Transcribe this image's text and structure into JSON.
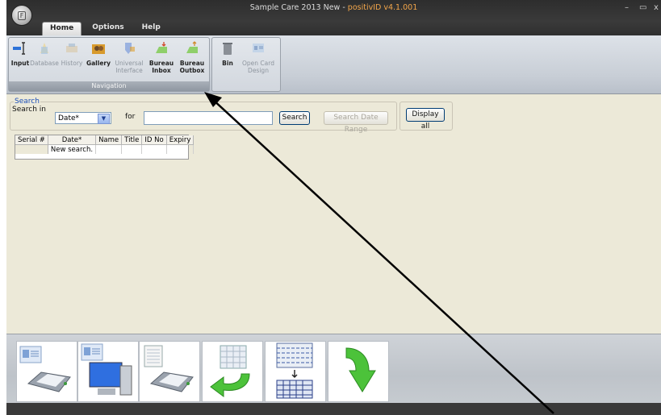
{
  "window": {
    "title_prefix": "Sample Care 2013 New - ",
    "title_brand": "positivID v4.1.001",
    "app_button_glyph": "F",
    "controls": {
      "minimize": "–",
      "maximize": "▭",
      "close": "x"
    }
  },
  "tabs": [
    {
      "label": "Home"
    },
    {
      "label": "Options"
    },
    {
      "label": "Help"
    }
  ],
  "ribbon": {
    "navigation": {
      "label": "Navigation",
      "buttons": [
        {
          "l1": "Input",
          "l2": "",
          "icon": "input-icon"
        },
        {
          "l1": "Database",
          "l2": "",
          "icon": "database-icon"
        },
        {
          "l1": "History",
          "l2": "",
          "icon": "history-icon"
        },
        {
          "l1": "Gallery",
          "l2": "",
          "icon": "gallery-icon"
        },
        {
          "l1": "Universal",
          "l2": "Interface",
          "icon": "universal-interface-icon"
        },
        {
          "l1": "Bureau",
          "l2": "Inbox",
          "icon": "bureau-inbox-icon"
        },
        {
          "l1": "Bureau",
          "l2": "Outbox",
          "icon": "bureau-outbox-icon"
        }
      ]
    },
    "tools": {
      "buttons": [
        {
          "l1": "Bin",
          "l2": "",
          "icon": "bin-icon"
        },
        {
          "l1": "Open Card",
          "l2": "Design",
          "icon": "open-card-design-icon"
        }
      ]
    }
  },
  "search": {
    "legend": "Search",
    "search_in_label": "Search in",
    "field_value": "Date*",
    "for_label": "for",
    "query_value": "",
    "search_button": "Search",
    "date_range_button": "Search Date Range",
    "display_all_button": "Display all"
  },
  "grid": {
    "columns": [
      "Serial #",
      "Date*",
      "Name",
      "Title",
      "ID No",
      "Expiry"
    ],
    "rows": [
      [
        "",
        "New search.",
        "",
        "",
        "",
        ""
      ]
    ]
  },
  "bottom_actions": [
    {
      "icon": "print-card-icon"
    },
    {
      "icon": "card-to-computer-icon"
    },
    {
      "icon": "print-list-icon"
    },
    {
      "icon": "return-back-icon"
    },
    {
      "icon": "table-import-icon"
    },
    {
      "icon": "proceed-down-icon"
    }
  ],
  "colors": {
    "accent": "#f3a64a",
    "link": "#1c4fb8",
    "arrow": "#000000"
  }
}
